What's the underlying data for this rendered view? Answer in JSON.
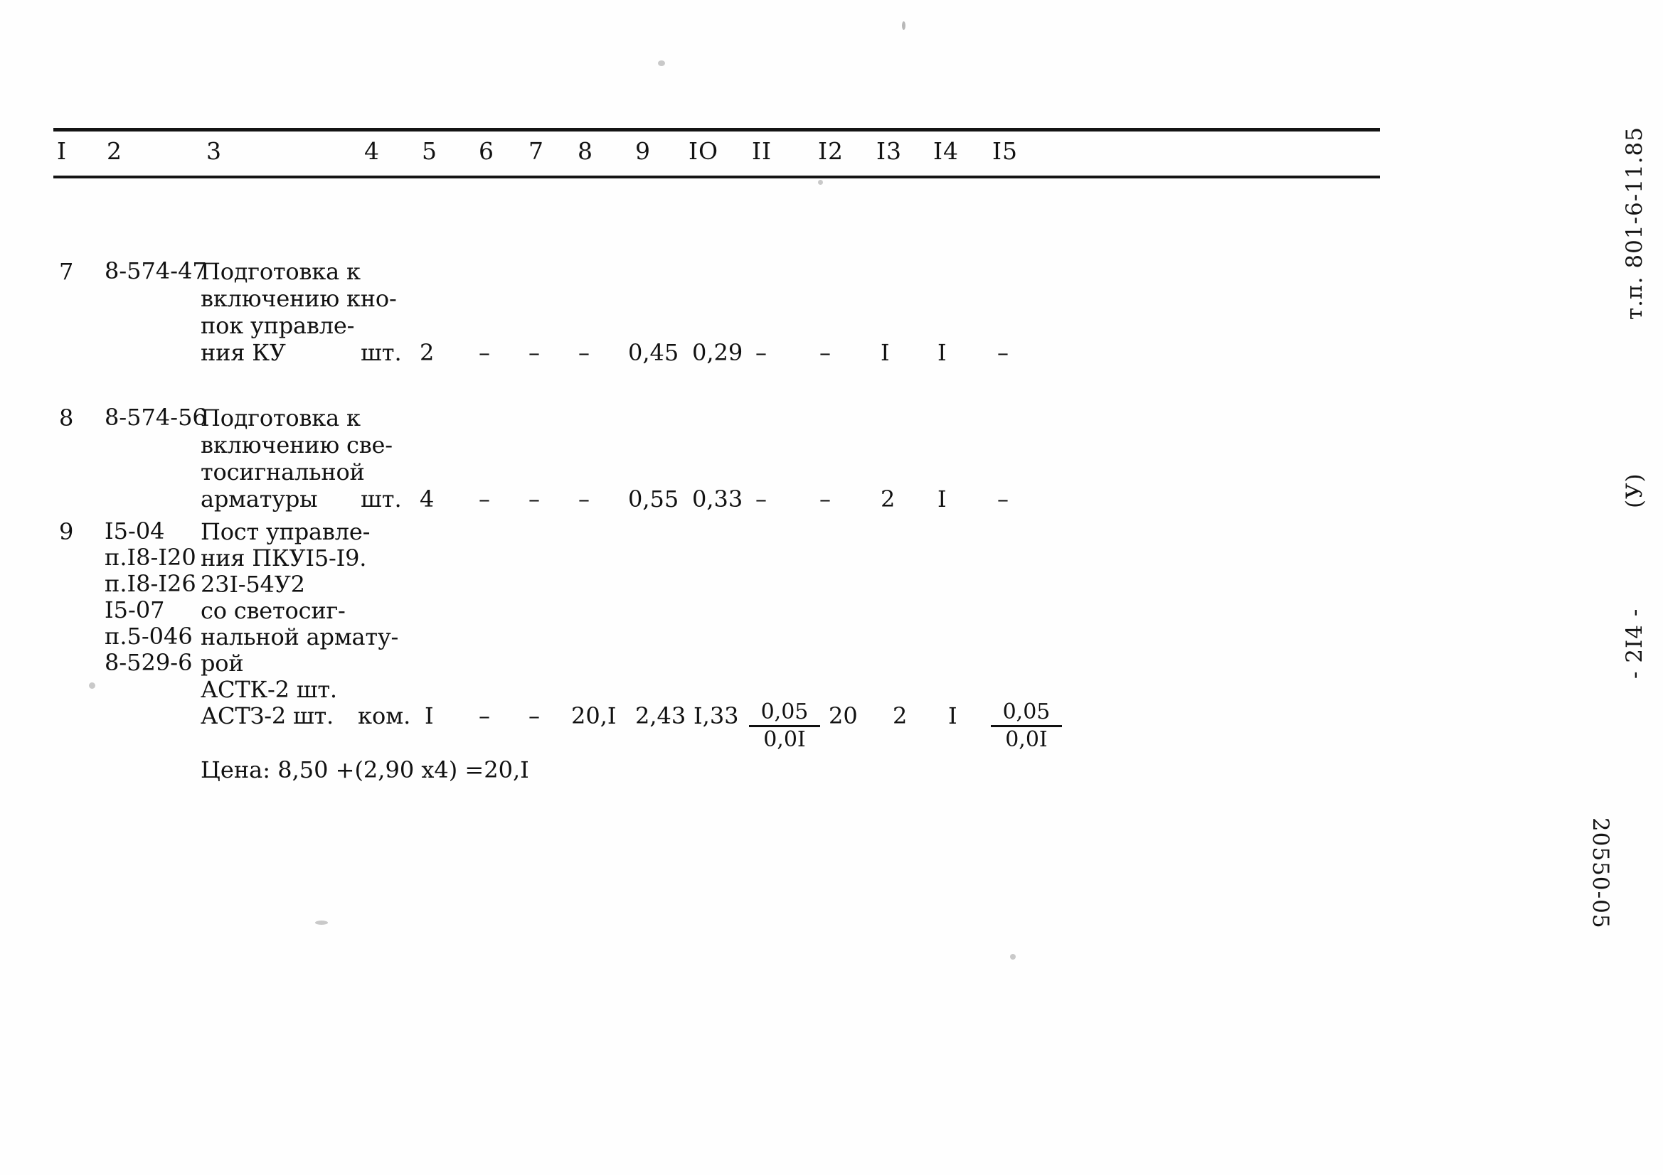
{
  "document": {
    "table_headers": [
      "I",
      "2",
      "3",
      "4",
      "5",
      "6",
      "7",
      "8",
      "9",
      "IO",
      "II",
      "I2",
      "I3",
      "I4",
      "I5"
    ],
    "rows": [
      {
        "num": "7",
        "code": "8-574-47",
        "desc_lines": [
          "Подготовка к",
          "включению кно-",
          "пок управле-",
          "ния КУ"
        ],
        "unit": "шт.",
        "values": [
          "2",
          "–",
          "–",
          "–",
          "0,45",
          "0,29",
          "–",
          "–",
          "I",
          "I",
          "–"
        ]
      },
      {
        "num": "8",
        "code": "8-574-56",
        "desc_lines": [
          "Подготовка к",
          "включению све-",
          "тосигнальной",
          "арматуры"
        ],
        "unit": "шт.",
        "values": [
          "4",
          "–",
          "–",
          "–",
          "0,55",
          "0,33",
          "–",
          "–",
          "2",
          "I",
          "–"
        ]
      },
      {
        "num": "9",
        "code_lines": [
          "I5-04",
          "п.I8-I20",
          "п.I8-I26",
          "I5-07",
          "п.5-046",
          "8-529-6"
        ],
        "desc_lines": [
          "Пост управле-",
          "ния ПКУI5-I9.",
          "23I-54У2",
          "со светосиг-",
          "нальной армату-",
          "рой",
          "АСТК-2 шт.",
          "АСТЗ-2 шт."
        ],
        "unit": "ком.",
        "values": [
          "I",
          "–",
          "–",
          "20,I",
          "2,43",
          "I,33"
        ],
        "fraction_col11": {
          "numerator": "0,05",
          "denominator": "0,0I"
        },
        "value_col12": "20",
        "value_col13": "2",
        "value_col14": "I",
        "fraction_col15": {
          "numerator": "0,05",
          "denominator": "0,0I"
        },
        "price_note": "Цена: 8,50 +(2,90 x4) =20,I"
      }
    ]
  },
  "margin": {
    "series_code": "т.п. 801-6-11.85",
    "variant": "(У)",
    "page_number": "- 2I4 -",
    "archive_code": "20550-05"
  }
}
